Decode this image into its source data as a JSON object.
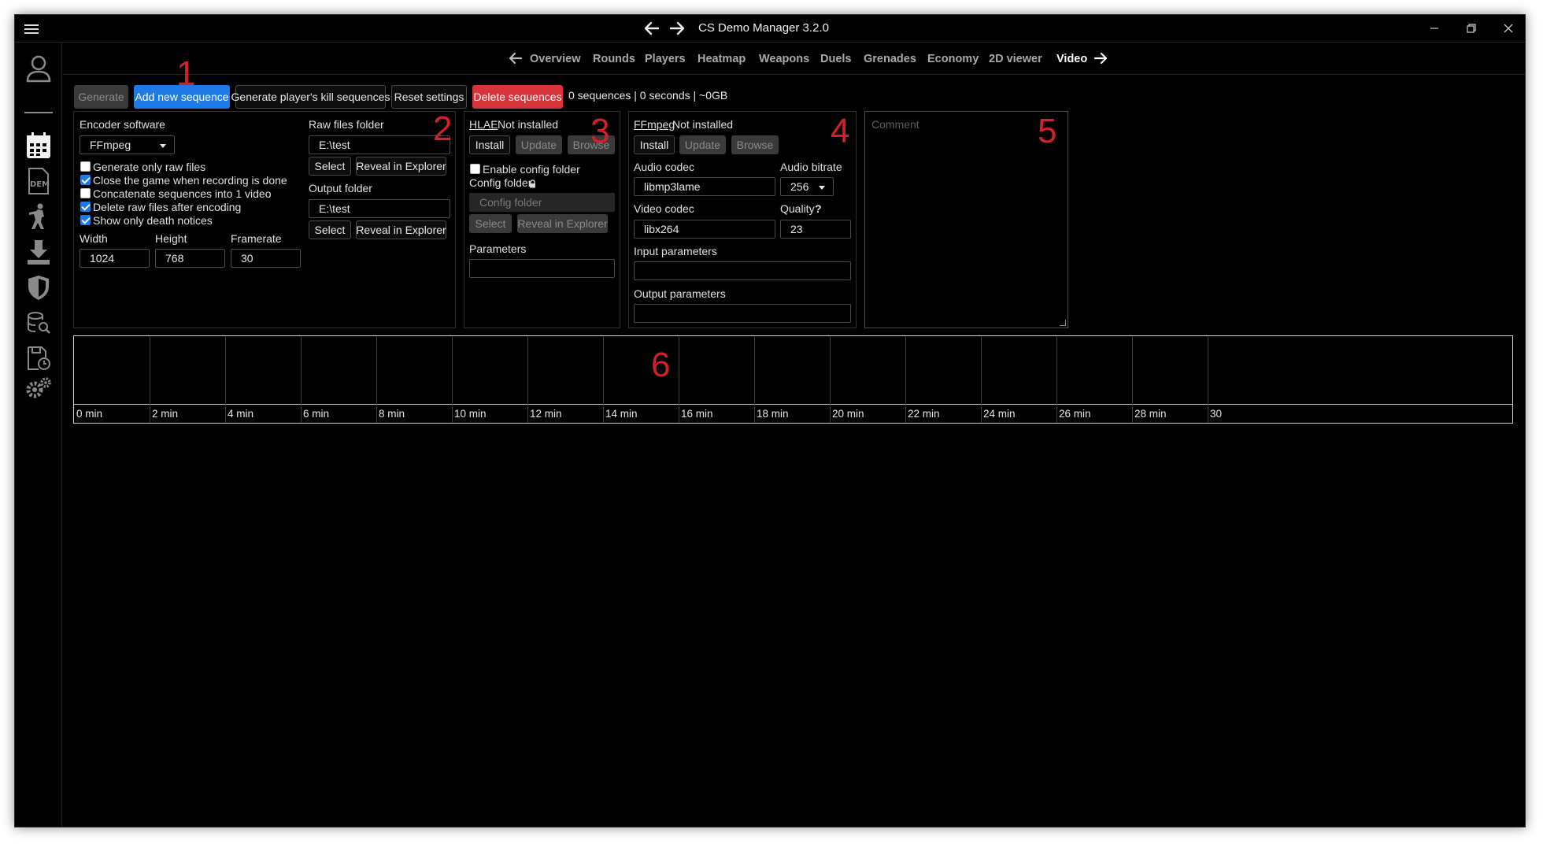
{
  "window": {
    "title": "CS Demo Manager 3.2.0"
  },
  "tabs": [
    {
      "label": "Overview"
    },
    {
      "label": "Rounds"
    },
    {
      "label": "Players"
    },
    {
      "label": "Heatmap"
    },
    {
      "label": "Weapons"
    },
    {
      "label": "Duels"
    },
    {
      "label": "Grenades"
    },
    {
      "label": "Economy"
    },
    {
      "label": "2D viewer"
    },
    {
      "label": "Video",
      "active": true
    }
  ],
  "toolbar": {
    "generate": "Generate",
    "add_sequence": "Add new sequence",
    "generate_kill_sequences": "Generate player's kill sequences",
    "reset_settings": "Reset settings",
    "delete_sequences": "Delete sequences",
    "status": "0 sequences | 0 seconds | ~0GB"
  },
  "encoder": {
    "label": "Encoder software",
    "value": "FFmpeg",
    "options": [
      {
        "label": "Generate only raw files",
        "checked": false
      },
      {
        "label": "Close the game when recording is done",
        "checked": true
      },
      {
        "label": "Concatenate sequences into 1 video",
        "checked": false
      },
      {
        "label": "Delete raw files after encoding",
        "checked": true
      },
      {
        "label": "Show only death notices",
        "checked": true
      }
    ],
    "width_label": "Width",
    "width": "1024",
    "height_label": "Height",
    "height": "768",
    "framerate_label": "Framerate",
    "framerate": "30"
  },
  "folders": {
    "raw_label": "Raw files folder",
    "raw_value": "E:\\test",
    "output_label": "Output folder",
    "output_value": "E:\\test",
    "select": "Select",
    "reveal": "Reveal in Explorer"
  },
  "hlae": {
    "name": "HLAE",
    "status": "Not installed",
    "install": "Install",
    "update": "Update",
    "browse": "Browse",
    "enable_config": "Enable config folder",
    "config_label": "Config folder",
    "config_placeholder": "Config folder",
    "select": "Select",
    "reveal": "Reveal in Explorer",
    "parameters_label": "Parameters",
    "parameters_value": ""
  },
  "ffmpeg": {
    "name": "FFmpeg",
    "status": "Not installed",
    "install": "Install",
    "update": "Update",
    "browse": "Browse",
    "audio_codec_label": "Audio codec",
    "audio_codec": "libmp3lame",
    "audio_bitrate_label": "Audio bitrate",
    "audio_bitrate": "256",
    "video_codec_label": "Video codec",
    "video_codec": "libx264",
    "quality_label": "Quality",
    "quality_help": "?",
    "quality": "23",
    "input_params_label": "Input parameters",
    "input_params": "",
    "output_params_label": "Output parameters",
    "output_params": ""
  },
  "comment": {
    "placeholder": "Comment"
  },
  "timeline": {
    "labels": [
      "0 min",
      "2 min",
      "4 min",
      "6 min",
      "8 min",
      "10 min",
      "12 min",
      "14 min",
      "16 min",
      "18 min",
      "20 min",
      "22 min",
      "24 min",
      "26 min",
      "28 min",
      "30"
    ]
  },
  "annotations": [
    "1",
    "2",
    "3",
    "4",
    "5",
    "6"
  ],
  "sidebar": {
    "items": [
      "account-icon",
      "calendar-icon",
      "demo-file-icon",
      "player-icon",
      "download-icon",
      "shield-icon",
      "search-database-icon",
      "history-icon",
      "settings-icon"
    ]
  },
  "colors": {
    "primary": "#1e7ae6",
    "danger": "#d7333b",
    "annotation": "#d2202a",
    "background": "#000000"
  }
}
